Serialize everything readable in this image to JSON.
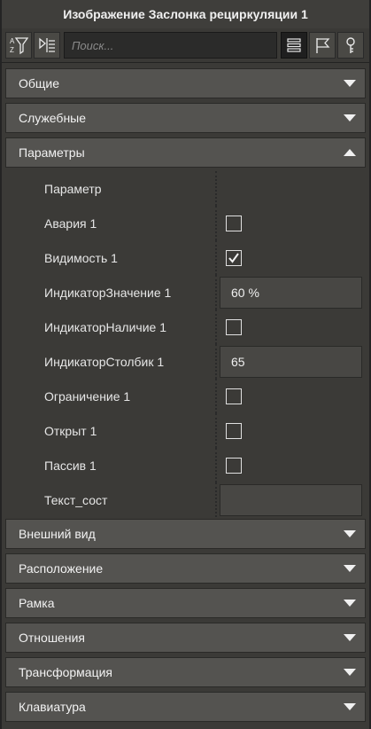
{
  "window": {
    "title": "Изображение Заслонка рециркуляции 1"
  },
  "toolbar": {
    "filter_icon": "sort-filter-icon",
    "expand_icon": "expand-collapse-icon",
    "search_placeholder": "Поиск...",
    "list_view_icon": "list-view-icon",
    "flag_icon": "flag-icon",
    "key_icon": "key-icon"
  },
  "sections_top": [
    {
      "label": "Общие",
      "expanded": false
    },
    {
      "label": "Служебные",
      "expanded": false
    },
    {
      "label": "Параметры",
      "expanded": true
    }
  ],
  "params": {
    "header": "Параметр",
    "rows": [
      {
        "name": "Авария 1",
        "type": "checkbox",
        "checked": false
      },
      {
        "name": "Видимость 1",
        "type": "checkbox",
        "checked": true
      },
      {
        "name": "ИндикаторЗначение 1",
        "type": "text",
        "value": "60 %"
      },
      {
        "name": "ИндикаторНаличие 1",
        "type": "checkbox",
        "checked": false
      },
      {
        "name": "ИндикаторСтолбик 1",
        "type": "text",
        "value": "65"
      },
      {
        "name": "Ограничение 1",
        "type": "checkbox",
        "checked": false
      },
      {
        "name": "Открыт 1",
        "type": "checkbox",
        "checked": false
      },
      {
        "name": "Пассив 1",
        "type": "checkbox",
        "checked": false
      },
      {
        "name": "Текст_сост",
        "type": "text",
        "value": ""
      }
    ]
  },
  "sections_bottom": [
    {
      "label": "Внешний вид",
      "expanded": false
    },
    {
      "label": "Расположение",
      "expanded": false
    },
    {
      "label": "Рамка",
      "expanded": false
    },
    {
      "label": "Отношения",
      "expanded": false
    },
    {
      "label": "Трансформация",
      "expanded": false
    },
    {
      "label": "Клавиатура",
      "expanded": false
    }
  ]
}
